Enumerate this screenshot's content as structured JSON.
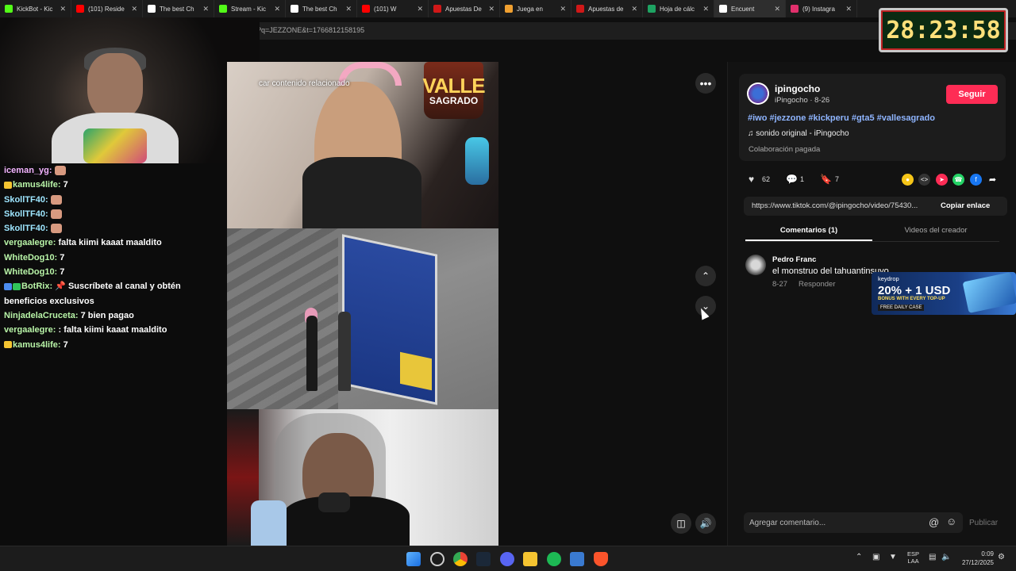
{
  "browser": {
    "tabs": [
      {
        "title": "KickBot - Kic",
        "color": "#53fc18"
      },
      {
        "title": "(101) Reside",
        "color": "#ff0000"
      },
      {
        "title": "The best Ch",
        "color": "#ffffff"
      },
      {
        "title": "Stream - Kic",
        "color": "#53fc18"
      },
      {
        "title": "The best Ch",
        "color": "#ffffff"
      },
      {
        "title": "(101) W",
        "color": "#ff0000"
      },
      {
        "title": "Apuestas De",
        "color": "#d01818"
      },
      {
        "title": "Juega en",
        "color": "#f0a030"
      },
      {
        "title": "Apuestas de",
        "color": "#d01818"
      },
      {
        "title": "Hoja de cálc",
        "color": "#1ea362"
      },
      {
        "title": "Encuent",
        "color": "#ffffff"
      },
      {
        "title": "(9) Instagra",
        "color": "#e1306c"
      }
    ],
    "url": "?q=JEZZONE&t=1766812158195"
  },
  "overlay": {
    "timer": "28:23:58"
  },
  "chat": {
    "messages": [
      {
        "user": "iceman_yg:",
        "text": ""
      },
      {
        "user": "kamus4life:",
        "text": "7"
      },
      {
        "user": "SkollTF40:",
        "text": ""
      },
      {
        "user": "SkollTF40:",
        "text": ""
      },
      {
        "user": "SkollTF40:",
        "text": ""
      },
      {
        "user": "vergaalegre:",
        "text": "falta kiimi kaaat maaldito"
      },
      {
        "user": "WhiteDog10:",
        "text": "7"
      },
      {
        "user": "WhiteDog10:",
        "text": "7"
      },
      {
        "user": "BotRix:",
        "text": "Suscríbete al canal y obtén beneficios exclusivos"
      },
      {
        "user": "NinjadelaCruceta:",
        "text": "7 bien pagao"
      },
      {
        "user": "vergaalegre:",
        "text": ": falta kiimi kaaat maaldito"
      },
      {
        "user": "kamus4life:",
        "text": "7"
      }
    ]
  },
  "video": {
    "search_placeholder": "car contenido relacionado",
    "logo_line1": "VALLE",
    "logo_line2": "SAGRADO"
  },
  "post": {
    "username": "ipingocho",
    "subline": "iPingocho · 8-26",
    "follow_label": "Seguir",
    "hashtags": "#iwo #jezzone #kickperu #gta5 #vallesagrado",
    "sound": "sonido original - iPingocho",
    "paid": "Colaboración pagada",
    "likes": "62",
    "comments": "1",
    "saves": "7",
    "link": "https://www.tiktok.com/@ipingocho/video/75430...",
    "copy_label": "Copiar enlace",
    "tab_comments": "Comentarios (1)",
    "tab_creator": "Videos del creador"
  },
  "comment": {
    "author": "Pedro Franc",
    "text": "el monstruo del tahuantinsuyo",
    "date": "8-27",
    "reply": "Responder"
  },
  "ad": {
    "brand": "keydrop",
    "headline": "20% + 1 USD",
    "sub": "BONUS WITH EVERY TOP-UP",
    "cta": "FREE DAILY CASE"
  },
  "composer": {
    "placeholder": "Agregar comentario...",
    "publish": "Publicar"
  },
  "taskbar": {
    "lang_line1": "ESP",
    "lang_line2": "LAA",
    "time": "0:09",
    "date": "27/12/2025"
  }
}
